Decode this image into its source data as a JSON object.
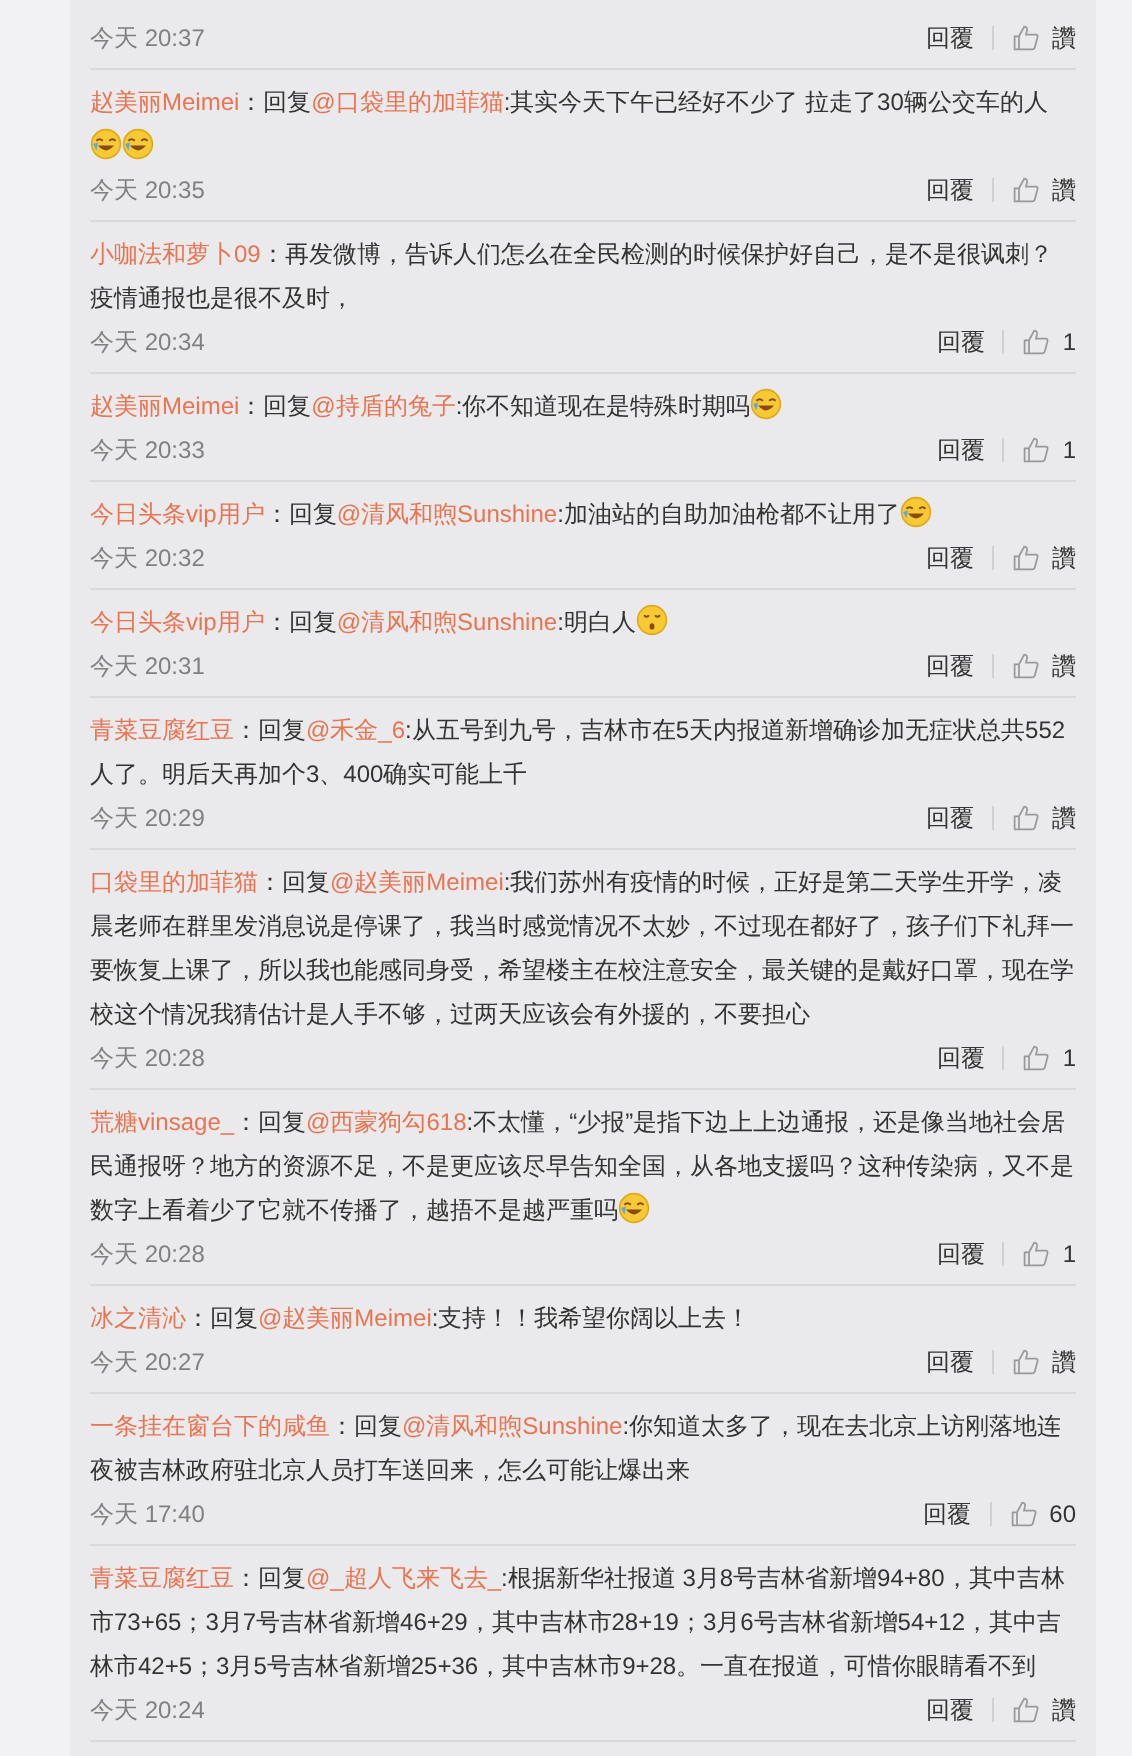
{
  "comments": [
    {
      "time": "今天 20:37",
      "reply": "回覆",
      "like": "讚"
    },
    {
      "name": "赵美丽Meimei",
      "lead": "：回复",
      "mention": "@口袋里的加菲猫",
      "text": ":其实今天下午已经好不少了 拉走了30辆公交车的人",
      "emojis": [
        {
          "kind": "laugh-cry"
        },
        {
          "kind": "laugh-cry"
        }
      ],
      "emoji_newline": true,
      "time": "今天 20:35",
      "reply": "回覆",
      "like": "讚"
    },
    {
      "name": "小咖法和萝卜09",
      "lead": "：",
      "text": "再发微博，告诉人们怎么在全民检测的时候保护好自己，是不是很讽刺？疫情通报也是很不及时，",
      "time": "今天 20:34",
      "reply": "回覆",
      "like": "1"
    },
    {
      "name": "赵美丽Meimei",
      "lead": "：回复",
      "mention": "@持盾的兔子",
      "text": ":你不知道现在是特殊时期吗",
      "emojis": [
        {
          "kind": "laugh-cry"
        }
      ],
      "time": "今天 20:33",
      "reply": "回覆",
      "like": "1"
    },
    {
      "name": "今日头条vip用户",
      "lead": "：回复",
      "mention": "@清风和煦Sunshine",
      "text": ":加油站的自助加油枪都不让用了",
      "emojis": [
        {
          "kind": "laugh-cry"
        }
      ],
      "time": "今天 20:32",
      "reply": "回覆",
      "like": "讚"
    },
    {
      "name": "今日头条vip用户",
      "lead": "：回复",
      "mention": "@清风和煦Sunshine",
      "text": ":明白人",
      "emojis": [
        {
          "kind": "worried"
        }
      ],
      "time": "今天 20:31",
      "reply": "回覆",
      "like": "讚"
    },
    {
      "name": "青菜豆腐红豆",
      "lead": "：回复",
      "mention": "@禾金_6",
      "text": ":从五号到九号，吉林市在5天内报道新增确诊加无症状总共552人了。明后天再加个3、400确实可能上千",
      "time": "今天 20:29",
      "reply": "回覆",
      "like": "讚"
    },
    {
      "name": "口袋里的加菲猫",
      "lead": "：回复",
      "mention": "@赵美丽Meimei",
      "text": ":我们苏州有疫情的时候，正好是第二天学生开学，凌晨老师在群里发消息说是停课了，我当时感觉情况不太妙，不过现在都好了，孩子们下礼拜一要恢复上课了，所以我也能感同身受，希望楼主在校注意安全，最关键的是戴好口罩，现在学校这个情况我猜估计是人手不够，过两天应该会有外援的，不要担心",
      "time": "今天 20:28",
      "reply": "回覆",
      "like": "1"
    },
    {
      "name": "荒糖vinsage_",
      "lead": "：回复",
      "mention": "@西蒙狗勾618",
      "text": ":不太懂，“少报”是指下边上上边通报，还是像当地社会居民通报呀？地方的资源不足，不是更应该尽早告知全国，从各地支援吗？这种传染病，又不是数字上看着少了它就不传播了，越捂不是越严重吗",
      "emojis": [
        {
          "kind": "laugh-cry"
        }
      ],
      "time": "今天 20:28",
      "reply": "回覆",
      "like": "1"
    },
    {
      "name": "冰之清沁",
      "lead": "：回复",
      "mention": "@赵美丽Meimei",
      "text": ":支持！！我希望你阔以上去！",
      "time": "今天 20:27",
      "reply": "回覆",
      "like": "讚"
    },
    {
      "name": "一条挂在窗台下的咸鱼",
      "lead": "：回复",
      "mention": "@清风和煦Sunshine",
      "text": ":你知道太多了，现在去北京上访刚落地连夜被吉林政府驻北京人员打车送回来，怎么可能让爆出来",
      "time": "今天 17:40",
      "reply": "回覆",
      "like": "60"
    },
    {
      "name": "青菜豆腐红豆",
      "lead": "：回复",
      "mention": "@_超人飞来飞去_",
      "text": ":根据新华社报道 3月8号吉林省新增94+80，其中吉林市73+65；3月7号吉林省新增46+29，其中吉林市28+19；3月6号吉林省新增54+12，其中吉林市42+5；3月5号吉林省新增25+36，其中吉林市9+28。一直在报道，可惜你眼睛看不到",
      "time": "今天 20:24",
      "reply": "回覆",
      "like": "讚"
    }
  ]
}
